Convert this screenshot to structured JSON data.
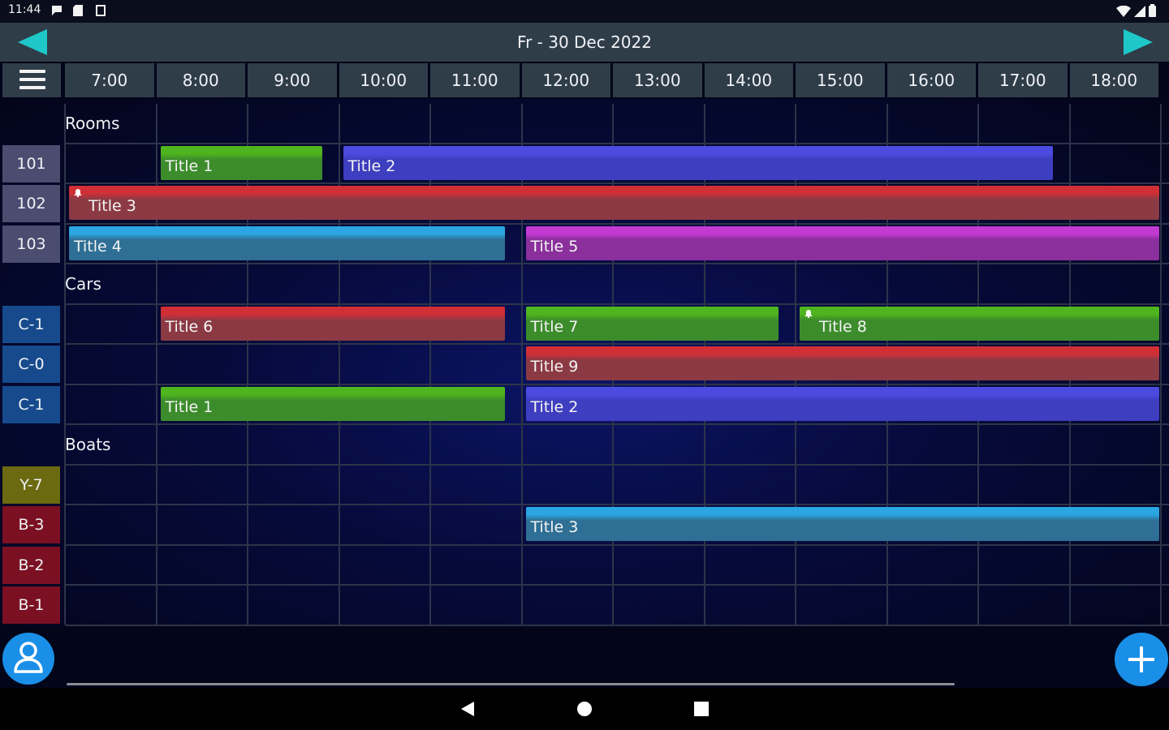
{
  "status_bar": {
    "time": "11:44",
    "icons": [
      "chat-icon",
      "sd-card-icon",
      "clipboard-icon"
    ],
    "right_icons": [
      "wifi-icon",
      "signal-icon",
      "battery-icon"
    ]
  },
  "header": {
    "title": "Fr - 30 Dec 2022",
    "prev_icon": "left-arrow-icon",
    "next_icon": "right-arrow-icon",
    "accent": "#1fc8c8"
  },
  "time_header": [
    "7:00",
    "8:00",
    "9:00",
    "10:00",
    "11:00",
    "12:00",
    "13:00",
    "14:00",
    "15:00",
    "16:00",
    "17:00",
    "18:00"
  ],
  "groups": [
    {
      "title": "Rooms",
      "rows": [
        {
          "label": "101",
          "color": "#4a4d6f",
          "events": [
            {
              "title": "Title 1",
              "start": "8:00",
              "end": "9:50",
              "color": "#3c8c2c",
              "top": "#4fb51e"
            },
            {
              "title": "Title 2",
              "start": "10:00",
              "end": "17:50",
              "color": "#3e3ec0",
              "top": "#4b4be0"
            }
          ]
        },
        {
          "label": "102",
          "color": "#4a4d6f",
          "events": [
            {
              "title": "Title 3",
              "start": "7:00",
              "end": "19:00",
              "color": "#8b3a44",
              "top": "#d12f36",
              "alarm": true
            }
          ]
        },
        {
          "label": "103",
          "color": "#4a4d6f",
          "events": [
            {
              "title": "Title 4",
              "start": "7:00",
              "end": "11:50",
              "color": "#2f6f95",
              "top": "#2aa6e2"
            },
            {
              "title": "Title 5",
              "start": "12:00",
              "end": "19:00",
              "color": "#8a2f9c",
              "top": "#c33ad3"
            }
          ]
        }
      ]
    },
    {
      "title": "Cars",
      "rows": [
        {
          "label": "C-1",
          "color": "#164a8c",
          "events": [
            {
              "title": "Title 6",
              "start": "8:00",
              "end": "11:50",
              "color": "#8b3a44",
              "top": "#d12f36"
            },
            {
              "title": "Title 7",
              "start": "12:00",
              "end": "14:50",
              "color": "#3c8c2c",
              "top": "#4fb51e"
            },
            {
              "title": "Title 8",
              "start": "15:00",
              "end": "19:00",
              "color": "#3c8c2c",
              "top": "#4fb51e",
              "alarm": true
            }
          ]
        },
        {
          "label": "C-0",
          "color": "#164a8c",
          "events": [
            {
              "title": "Title 9",
              "start": "12:00",
              "end": "19:00",
              "color": "#8b3a44",
              "top": "#d12f36"
            }
          ]
        },
        {
          "label": "C-1",
          "color": "#164a8c",
          "events": [
            {
              "title": "Title 1",
              "start": "8:00",
              "end": "11:50",
              "color": "#3c8c2c",
              "top": "#4fb51e"
            },
            {
              "title": "Title 2",
              "start": "12:00",
              "end": "19:00",
              "color": "#3e3ec0",
              "top": "#4b4be0"
            }
          ]
        }
      ]
    },
    {
      "title": "Boats",
      "rows": [
        {
          "label": "Y-7",
          "color": "#6b6a10",
          "events": []
        },
        {
          "label": "B-3",
          "color": "#7a1022",
          "events": [
            {
              "title": "Title 3",
              "start": "12:00",
              "end": "19:00",
              "color": "#2f6f95",
              "top": "#2aa6e2"
            }
          ]
        },
        {
          "label": "B-2",
          "color": "#7a1022",
          "events": []
        },
        {
          "label": "B-1",
          "color": "#7a1022",
          "events": []
        }
      ]
    }
  ],
  "fab": {
    "user_icon": "person-icon",
    "add_icon": "plus-icon"
  },
  "system_nav": [
    "back-icon",
    "home-icon",
    "recents-icon"
  ]
}
